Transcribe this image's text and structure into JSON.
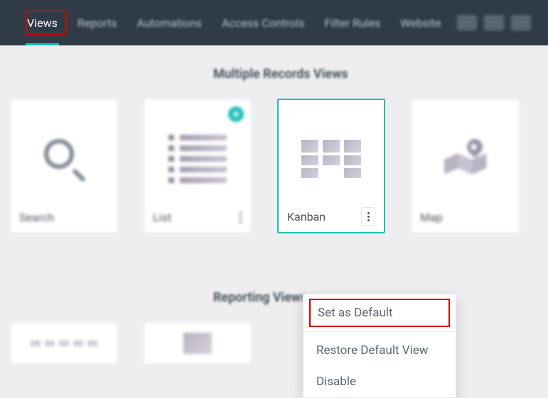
{
  "topbar": {
    "tabs": [
      {
        "label": "Views",
        "active": true
      },
      {
        "label": "Reports",
        "active": false
      },
      {
        "label": "Automations",
        "active": false
      },
      {
        "label": "Access Controls",
        "active": false
      },
      {
        "label": "Filter Rules",
        "active": false
      },
      {
        "label": "Website",
        "active": false
      }
    ]
  },
  "sections": {
    "multiple": {
      "title": "Multiple Records Views"
    },
    "reporting": {
      "title": "Reporting Views"
    }
  },
  "cards": {
    "search": {
      "label": "Search"
    },
    "list": {
      "label": "List"
    },
    "kanban": {
      "label": "Kanban"
    },
    "map": {
      "label": "Map"
    }
  },
  "menu": {
    "set_default": "Set as Default",
    "restore": "Restore Default View",
    "disable": "Disable"
  }
}
